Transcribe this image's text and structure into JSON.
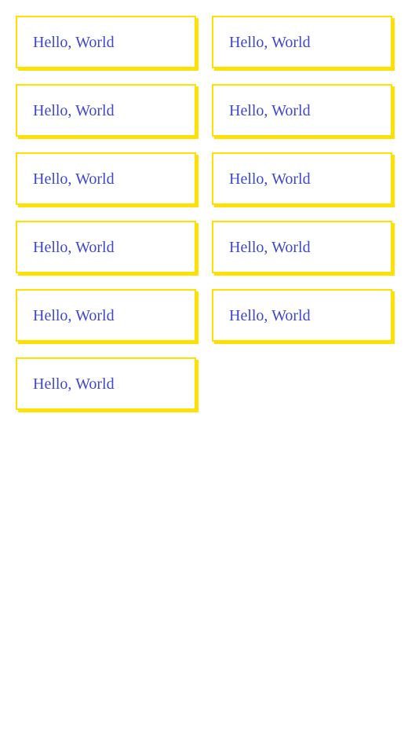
{
  "colors": {
    "card_border": "#FFE000",
    "card_text": "#3F48CC",
    "background": "#FFFFFF"
  },
  "cards": [
    {
      "label": "Hello, World"
    },
    {
      "label": "Hello, World"
    },
    {
      "label": "Hello, World"
    },
    {
      "label": "Hello, World"
    },
    {
      "label": "Hello, World"
    },
    {
      "label": "Hello, World"
    },
    {
      "label": "Hello, World"
    },
    {
      "label": "Hello, World"
    },
    {
      "label": "Hello, World"
    },
    {
      "label": "Hello, World"
    },
    {
      "label": "Hello, World"
    }
  ]
}
